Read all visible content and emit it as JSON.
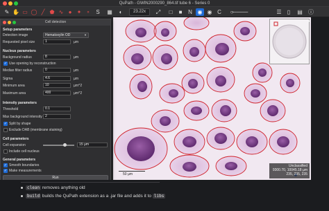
{
  "window": {
    "title": "QuPath - GWIN2000290_864.tif tube 6 - Series 0",
    "traffic_colors": [
      "#ff5f57",
      "#febc2e",
      "#28c840"
    ]
  },
  "toolbar": {
    "zoom": "23.22x",
    "buttons": [
      "pointer",
      "move",
      "rectangle",
      "ellipse",
      "line",
      "polygon",
      "polyline",
      "brush",
      "wand",
      "points",
      "selection-mode",
      "grid",
      "brightness",
      "zoom-fit"
    ]
  },
  "dialog": {
    "title": "Cell detection",
    "setup": {
      "header": "Setup parameters",
      "detection_image_label": "Detection image",
      "detection_image_value": "Hematoxylin OD",
      "pixel_size_label": "Requested pixel size",
      "pixel_size_value": "1",
      "pixel_size_unit": "µm"
    },
    "nucleus": {
      "header": "Nucleus parameters",
      "bg_radius_label": "Background radius",
      "bg_radius_value": "8",
      "bg_radius_unit": "µm",
      "opening_label": "Use opening by reconstruction",
      "median_label": "Median filter radius",
      "median_value": "0",
      "median_unit": "µm",
      "sigma_label": "Sigma",
      "sigma_value": "4.6",
      "sigma_unit": "µm",
      "min_area_label": "Minimum area",
      "min_area_value": "10",
      "min_area_unit": "µm^2",
      "max_area_label": "Maximum area",
      "max_area_value": "400",
      "max_area_unit": "µm^2"
    },
    "intensity": {
      "header": "Intensity parameters",
      "threshold_label": "Threshold",
      "threshold_value": "0.1",
      "max_bg_label": "Max background intensity",
      "max_bg_value": "2",
      "split_label": "Split by shape",
      "exclude_dab_label": "Exclude DAB (membrane staining)"
    },
    "cell": {
      "header": "Cell parameters",
      "expansion_label": "Cell expansion",
      "expansion_value": "15 µm",
      "include_nucleus_label": "Include cell nucleus"
    },
    "general": {
      "header": "General parameters",
      "smooth_label": "Smooth boundaries",
      "measurements_label": "Make measurements"
    },
    "run_label": "Run"
  },
  "viewer": {
    "scale_label": "50 µm",
    "info_line1": "Unclassified",
    "info_line2": "9300.70, 10045.18 µm",
    "info_line3": "235, 235, 235"
  },
  "docs": {
    "line1_code": "clean",
    "line1_text": " removes anything old",
    "line2_code": "build",
    "line2_text": " builds the QuPath extension as a .jar file and adds it to ",
    "line2_code2": "libs"
  }
}
